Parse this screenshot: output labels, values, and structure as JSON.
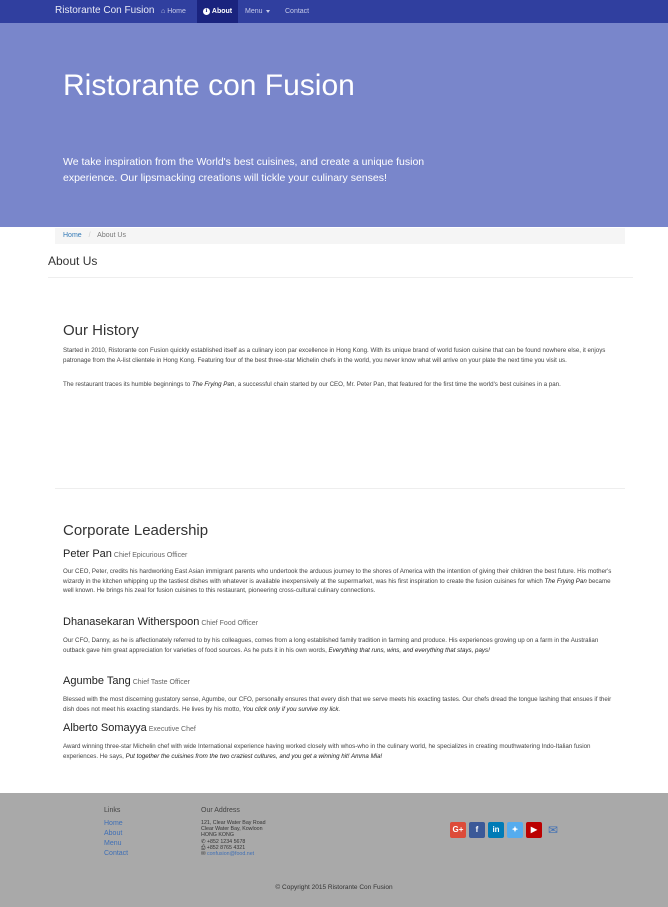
{
  "navbar": {
    "brand": "Ristorante Con Fusion",
    "home": "Home",
    "about": "About",
    "menu": "Menu",
    "contact": "Contact"
  },
  "jumbotron": {
    "title": "Ristorante con Fusion",
    "tagline": "We take inspiration from the World's best cuisines, and create a unique fusion experience. Our lipsmacking creations will tickle your culinary senses!"
  },
  "breadcrumb": {
    "home": "Home",
    "current": "About Us"
  },
  "page_title": "About Us",
  "history": {
    "heading": "Our History",
    "p1": "Started in 2010, Ristorante con Fusion quickly established itself as a culinary icon par excellence in Hong Kong. With its unique brand of world fusion cuisine that can be found nowhere else, it enjoys patronage from the A-list clientele in Hong Kong. Featuring four of the best three-star Michelin chefs in the world, you never know what will arrive on your plate the next time you visit us.",
    "p2_before": "The restaurant traces its humble beginnings to ",
    "p2_em": "The Frying Pan",
    "p2_after": ", a successful chain started by our CEO, Mr. Peter Pan, that featured for the first time the world's best cuisines in a pan."
  },
  "leadership": {
    "heading": "Corporate Leadership",
    "leaders": [
      {
        "name": "Peter Pan",
        "role": "Chief Epicurious Officer",
        "bio": "Our CEO, Peter, credits his hardworking East Asian immigrant parents who undertook the arduous journey to the shores of America with the intention of giving their children the best future. His mother's wizardy in the kitchen whipping up the tastiest dishes with whatever is available inexpensively at the supermarket, was his first inspiration to create the fusion cuisines for which ",
        "bio_em": "The Frying Pan",
        "bio_after": " became well known. He brings his zeal for fusion cuisines to this restaurant, pioneering cross-cultural culinary connections."
      },
      {
        "name": "Dhanasekaran Witherspoon",
        "role": "Chief Food Officer",
        "bio": "Our CFO, Danny, as he is affectionately referred to by his colleagues, comes from a long established family tradition in farming and produce. His experiences growing up on a farm in the Australian outback gave him great appreciation for varieties of food sources. As he puts it in his own words, ",
        "bio_em": "Everything that runs, wins, and everything that stays, pays!",
        "bio_after": ""
      },
      {
        "name": "Agumbe Tang",
        "role": "Chief Taste Officer",
        "bio": "Blessed with the most discerning gustatory sense, Agumbe, our CFO, personally ensures that every dish that we serve meets his exacting tastes. Our chefs dread the tongue lashing that ensues if their dish does not meet his exacting standards. He lives by his motto, ",
        "bio_em": "You click only if you survive my lick.",
        "bio_after": ""
      },
      {
        "name": "Alberto Somayya",
        "role": "Executive Chef",
        "bio": "Award winning three-star Michelin chef with wide International experience having worked closely with whos-who in the culinary world, he specializes in creating mouthwatering Indo-Italian fusion experiences. He says, ",
        "bio_em": "Put together the cuisines from the two craziest cultures, and you get a winning hit! Amma Mia!",
        "bio_after": ""
      }
    ]
  },
  "footer": {
    "links_heading": "Links",
    "links": [
      "Home",
      "About",
      "Menu",
      "Contact"
    ],
    "address_heading": "Our Address",
    "address": [
      "121, Clear Water Bay Road",
      "Clear Water Bay, Kowloon",
      "HONG KONG"
    ],
    "phone": "+852 1234 5678",
    "fax": "+852 8765 4321",
    "email": "confusion@food.net",
    "copyright": "© Copyright 2015 Ristorante Con Fusion",
    "colors": {
      "google": "#dd4b39",
      "facebook": "#3b5998",
      "linkedin": "#007bb6",
      "twitter": "#55acee",
      "youtube": "#bb0000",
      "mail": "#3f6fb5"
    }
  }
}
